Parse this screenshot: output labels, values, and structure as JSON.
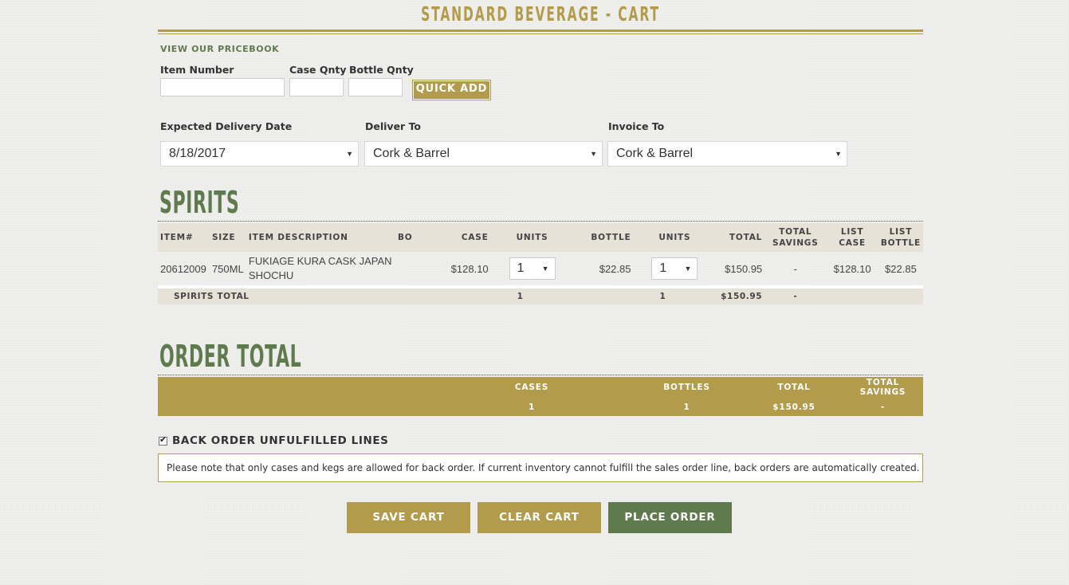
{
  "header": {
    "title": "STANDARD BEVERAGE - CART",
    "pricebook_link": "VIEW OUR PRICEBOOK"
  },
  "quick_add": {
    "item_number_label": "Item Number",
    "case_qty_label": "Case Qnty",
    "bottle_qty_label": "Bottle Qnty",
    "item_number_value": "",
    "case_qty_value": "",
    "bottle_qty_value": "",
    "button_label": "QUICK ADD"
  },
  "delivery": {
    "date_label": "Expected Delivery Date",
    "date_value": "8/18/2017",
    "deliver_to_label": "Deliver To",
    "deliver_to_value": "Cork & Barrel",
    "invoice_to_label": "Invoice To",
    "invoice_to_value": "Cork & Barrel"
  },
  "spirits": {
    "section_title": "SPIRITS",
    "columns": {
      "item": "ITEM#",
      "size": "SIZE",
      "description": "ITEM DESCRIPTION",
      "bo": "BO",
      "case": "CASE",
      "units1": "UNITS",
      "bottle": "BOTTLE",
      "units2": "UNITS",
      "total": "TOTAL",
      "total_savings_1": "TOTAL",
      "total_savings_2": "SAVINGS",
      "list_case_1": "LIST",
      "list_case_2": "CASE",
      "list_bottle_1": "LIST",
      "list_bottle_2": "BOTTLE"
    },
    "rows": [
      {
        "item": "20612009",
        "size": "750ML",
        "description": "FUKIAGE KURA CASK JAPAN SHOCHU",
        "bo": "",
        "case": "$128.10",
        "case_units": "1",
        "bottle": "$22.85",
        "bottle_units": "1",
        "total": "$150.95",
        "savings": "-",
        "list_case": "$128.10",
        "list_bottle": "$22.85"
      }
    ],
    "total_row": {
      "label": "SPIRITS TOTAL",
      "case_units": "1",
      "bottle_units": "1",
      "total": "$150.95",
      "savings": "-"
    }
  },
  "order_total": {
    "section_title": "ORDER TOTAL",
    "cases_label": "CASES",
    "bottles_label": "BOTTLES",
    "total_label": "TOTAL",
    "savings_label": "TOTAL SAVINGS",
    "cases": "1",
    "bottles": "1",
    "total": "$150.95",
    "savings": "-"
  },
  "backorder": {
    "checked": true,
    "label": "BACK ORDER UNFULFILLED LINES",
    "note": "Please note that only cases and kegs are allowed for back order. If current inventory cannot fulfill the sales order line, back orders are automatically created."
  },
  "actions": {
    "save": "SAVE CART",
    "clear": "CLEAR CART",
    "place": "PLACE ORDER"
  },
  "colors": {
    "gold": "#b39b4c",
    "green": "#5f7a4d",
    "table_header": "#e6e2d8"
  }
}
